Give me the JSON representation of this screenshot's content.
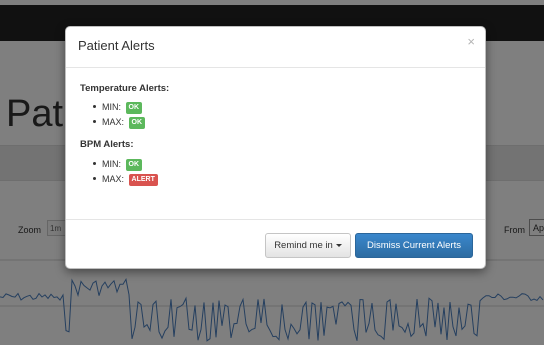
{
  "background": {
    "page_title": "Patie",
    "zoom_label": "Zoom",
    "zoom_button": "1m",
    "from_label": "From",
    "from_value": "Ap"
  },
  "modal": {
    "title": "Patient Alerts",
    "close_symbol": "×",
    "sections": [
      {
        "title": "Temperature Alerts:",
        "items": [
          {
            "label": "MIN:",
            "badge": "OK",
            "status": "ok"
          },
          {
            "label": "MAX:",
            "badge": "OK",
            "status": "ok"
          }
        ]
      },
      {
        "title": "BPM Alerts:",
        "items": [
          {
            "label": "MIN:",
            "badge": "OK",
            "status": "ok"
          },
          {
            "label": "MAX:",
            "badge": "ALERT",
            "status": "alert"
          }
        ]
      }
    ],
    "remind_button": "Remind me in",
    "dismiss_button": "Dismiss Current Alerts"
  },
  "colors": {
    "ok": "#5cb85c",
    "alert": "#d9534f",
    "primary": "#337ab7",
    "chart_line": "#4a7fbf"
  },
  "icons": {
    "close": "close-icon",
    "caret": "caret-down-icon"
  }
}
